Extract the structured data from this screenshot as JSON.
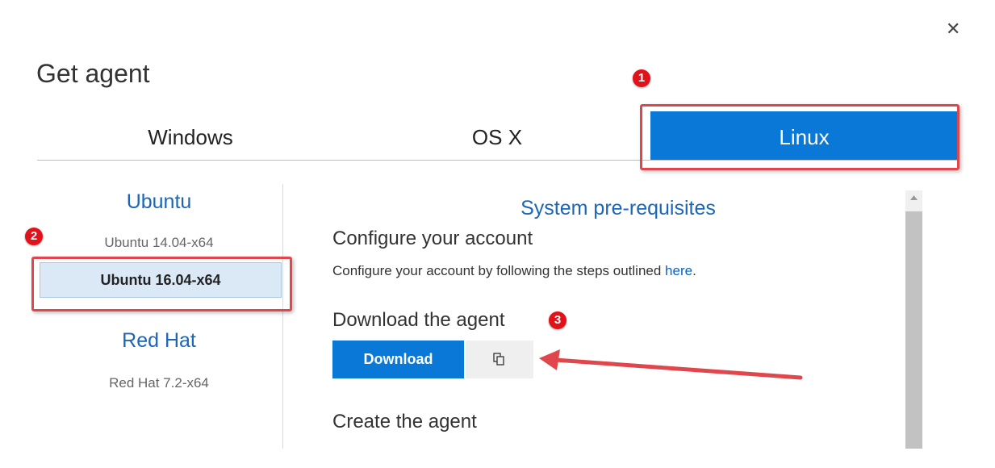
{
  "dialog": {
    "title": "Get agent",
    "close_glyph": "✕"
  },
  "tabs": [
    {
      "label": "Windows",
      "selected": false
    },
    {
      "label": "OS X",
      "selected": false
    },
    {
      "label": "Linux",
      "selected": true
    }
  ],
  "sidebar": {
    "groups": [
      {
        "label": "Ubuntu",
        "items": [
          "Ubuntu 14.04-x64",
          "Ubuntu 16.04-x64"
        ],
        "selected": "Ubuntu 16.04-x64"
      },
      {
        "label": "Red Hat",
        "items": [
          "Red Hat 7.2-x64"
        ]
      }
    ]
  },
  "content": {
    "section_title": "System pre-requisites",
    "configure_heading": "Configure your account",
    "configure_text": "Configure your account by following the steps outlined ",
    "configure_link": "here",
    "configure_suffix": ".",
    "download_heading": "Download the agent",
    "download_button": "Download",
    "copy_icon": "copy-icon",
    "create_heading": "Create the agent"
  },
  "annotations": {
    "badge_1": "1",
    "badge_2": "2",
    "badge_3": "3",
    "color": "#e2121a"
  },
  "colors": {
    "accent": "#0a78d7",
    "link": "#1a66b8",
    "selected_bg": "#dbe8f6",
    "callout": "#e0474c"
  }
}
